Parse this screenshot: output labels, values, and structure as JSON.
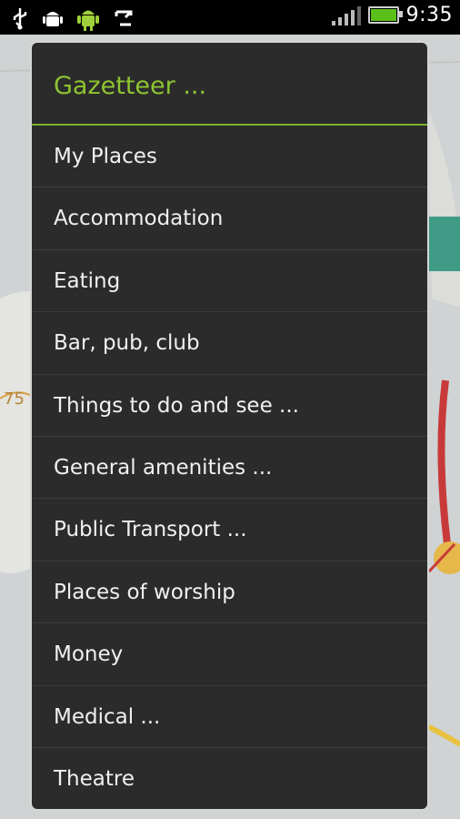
{
  "status_bar": {
    "time": "9:35",
    "icons": [
      "usb-icon",
      "android-debug-icon",
      "android-icon",
      "sync-icon",
      "signal-icon",
      "battery-icon"
    ]
  },
  "dialog": {
    "title": "Gazetteer ...",
    "accent_color": "#8ec431",
    "items": [
      {
        "label": "My Places"
      },
      {
        "label": "Accommodation"
      },
      {
        "label": "Eating"
      },
      {
        "label": "Bar, pub, club"
      },
      {
        "label": "Things to do and see ..."
      },
      {
        "label": "General amenities ..."
      },
      {
        "label": "Public Transport ..."
      },
      {
        "label": "Places of worship"
      },
      {
        "label": "Money"
      },
      {
        "label": "Medical ..."
      },
      {
        "label": "Theatre"
      }
    ]
  },
  "map": {
    "road_label": "75"
  }
}
